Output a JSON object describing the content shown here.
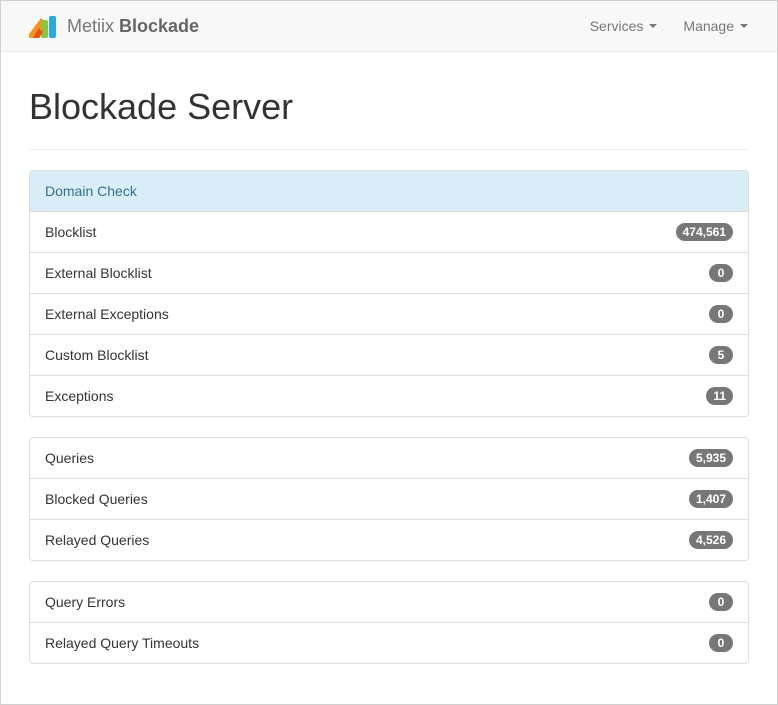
{
  "navbar": {
    "brand_prefix": "Metiix",
    "brand_name": "Blockade",
    "menu": [
      {
        "label": "Services"
      },
      {
        "label": "Manage"
      }
    ]
  },
  "page": {
    "title": "Blockade Server"
  },
  "domain_list": {
    "header": "Domain Check",
    "items": [
      {
        "label": "Blocklist",
        "count": "474,561"
      },
      {
        "label": "External Blocklist",
        "count": "0"
      },
      {
        "label": "External Exceptions",
        "count": "0"
      },
      {
        "label": "Custom Blocklist",
        "count": "5"
      },
      {
        "label": "Exceptions",
        "count": "11"
      }
    ]
  },
  "query_list": {
    "items": [
      {
        "label": "Queries",
        "count": "5,935"
      },
      {
        "label": "Blocked Queries",
        "count": "1,407"
      },
      {
        "label": "Relayed Queries",
        "count": "4,526"
      }
    ]
  },
  "error_list": {
    "items": [
      {
        "label": "Query Errors",
        "count": "0"
      },
      {
        "label": "Relayed Query Timeouts",
        "count": "0"
      }
    ]
  },
  "colors": {
    "navbar_bg": "#f8f8f8",
    "header_bg": "#d9edf7",
    "header_text": "#31708f",
    "badge_bg": "#777777"
  }
}
